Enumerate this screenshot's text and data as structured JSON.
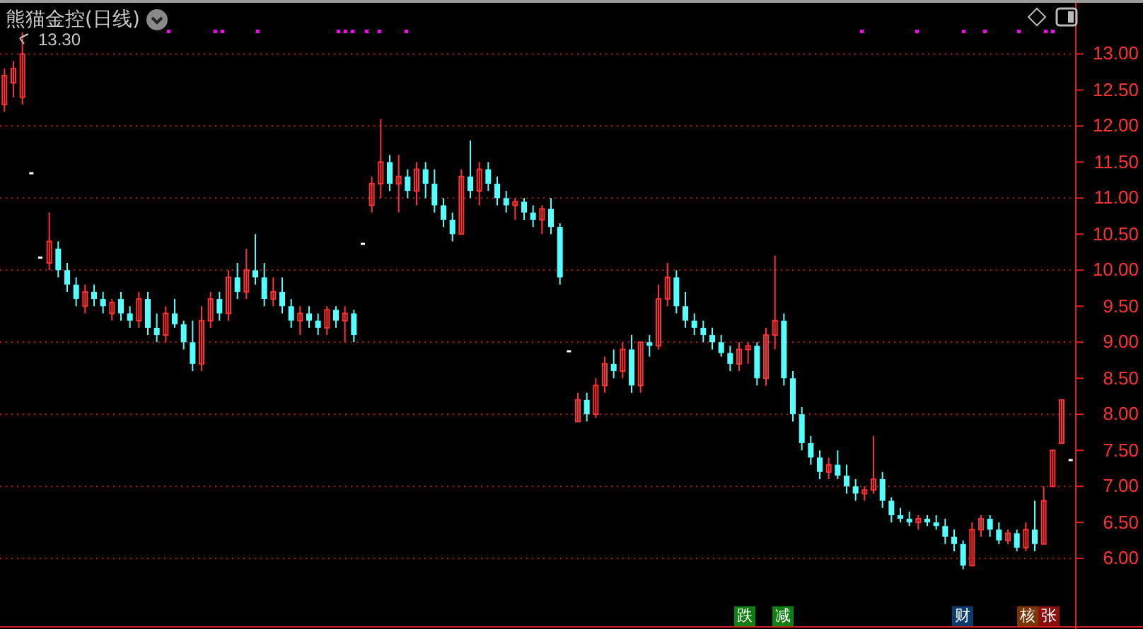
{
  "chart": {
    "title": "熊猫金控(日线)",
    "high_label": "13.30",
    "chart_data": {
      "type": "candlestick",
      "ylim": [
        5.06,
        13.71
      ],
      "grid": true,
      "categories": [
        null,
        null,
        null,
        null,
        null,
        null,
        null,
        null,
        null,
        null,
        null,
        null,
        null,
        null,
        null,
        null,
        null,
        null,
        null,
        null,
        null,
        null,
        null,
        null,
        null,
        null,
        null,
        null,
        null,
        null,
        null,
        null,
        null,
        null,
        null,
        null,
        null,
        null,
        null,
        null,
        null,
        null,
        null,
        null,
        null,
        null,
        null,
        null,
        null,
        null,
        null,
        null,
        null,
        null,
        null,
        null,
        null,
        null,
        null,
        null,
        null,
        null,
        null,
        null,
        null,
        null,
        null,
        null,
        null,
        null,
        null,
        null,
        null,
        null,
        null,
        null,
        null,
        null,
        null,
        null,
        null,
        null,
        null,
        null,
        null,
        null,
        null,
        null,
        null,
        null,
        null,
        null,
        null,
        null,
        null,
        null,
        null,
        null,
        null,
        null,
        null,
        null,
        null,
        null,
        null,
        null,
        null,
        null,
        null,
        null,
        null,
        null,
        null,
        null,
        null,
        null,
        null,
        null,
        null,
        null
      ],
      "yticks": [
        {
          "value": 13,
          "label": "13.00"
        },
        {
          "value": 12.5,
          "label": "12.50"
        },
        {
          "value": 12,
          "label": "12.00"
        },
        {
          "value": 11.5,
          "label": "11.50"
        },
        {
          "value": 11,
          "label": "11.00"
        },
        {
          "value": 10.5,
          "label": "10.50"
        },
        {
          "value": 10,
          "label": "10.00"
        },
        {
          "value": 9.5,
          "label": "9.50"
        },
        {
          "value": 9,
          "label": "9.00"
        },
        {
          "value": 8.5,
          "label": "8.50"
        },
        {
          "value": 8,
          "label": "8.00"
        },
        {
          "value": 7.5,
          "label": "7.50"
        },
        {
          "value": 7,
          "label": "7.00"
        },
        {
          "value": 6.5,
          "label": "6.50"
        },
        {
          "value": 6,
          "label": "6.00"
        }
      ],
      "ohlc": [
        [
          12.3,
          12.8,
          12.2,
          12.7
        ],
        [
          12.6,
          12.9,
          12.4,
          12.8
        ],
        [
          12.4,
          13.3,
          12.3,
          13.0
        ],
        [
          11.35,
          11.35,
          11.35,
          11.35
        ],
        [
          10.18,
          10.18,
          10.18,
          10.18
        ],
        [
          10.1,
          10.8,
          10.0,
          10.4
        ],
        [
          10.3,
          10.4,
          9.9,
          10.0
        ],
        [
          10.0,
          10.1,
          9.7,
          9.8
        ],
        [
          9.8,
          9.9,
          9.5,
          9.6
        ],
        [
          9.5,
          9.8,
          9.4,
          9.7
        ],
        [
          9.7,
          9.8,
          9.5,
          9.6
        ],
        [
          9.6,
          9.7,
          9.4,
          9.5
        ],
        [
          9.4,
          9.6,
          9.3,
          9.55
        ],
        [
          9.6,
          9.7,
          9.3,
          9.4
        ],
        [
          9.4,
          9.5,
          9.2,
          9.3
        ],
        [
          9.3,
          9.7,
          9.2,
          9.6
        ],
        [
          9.6,
          9.7,
          9.1,
          9.2
        ],
        [
          9.2,
          9.4,
          9.0,
          9.1
        ],
        [
          9.1,
          9.5,
          9.0,
          9.4
        ],
        [
          9.4,
          9.6,
          9.2,
          9.25
        ],
        [
          9.25,
          9.3,
          8.9,
          9.0
        ],
        [
          9.0,
          9.3,
          8.6,
          8.7
        ],
        [
          8.7,
          9.5,
          8.6,
          9.3
        ],
        [
          9.3,
          9.7,
          9.2,
          9.6
        ],
        [
          9.6,
          9.7,
          9.3,
          9.4
        ],
        [
          9.4,
          10.0,
          9.3,
          9.9
        ],
        [
          9.9,
          10.1,
          9.6,
          9.7
        ],
        [
          9.7,
          10.3,
          9.6,
          10.0
        ],
        [
          10.0,
          10.5,
          9.8,
          9.9
        ],
        [
          9.9,
          10.1,
          9.5,
          9.6
        ],
        [
          9.6,
          9.9,
          9.5,
          9.7
        ],
        [
          9.7,
          9.9,
          9.4,
          9.5
        ],
        [
          9.5,
          9.6,
          9.2,
          9.3
        ],
        [
          9.3,
          9.5,
          9.1,
          9.4
        ],
        [
          9.4,
          9.5,
          9.2,
          9.3
        ],
        [
          9.3,
          9.4,
          9.1,
          9.2
        ],
        [
          9.2,
          9.5,
          9.1,
          9.45
        ],
        [
          9.45,
          9.5,
          9.2,
          9.3
        ],
        [
          9.3,
          9.5,
          9.0,
          9.4
        ],
        [
          9.4,
          9.45,
          9.0,
          9.1
        ],
        [
          10.37,
          10.37,
          10.37,
          10.37
        ],
        [
          10.9,
          11.3,
          10.8,
          11.2
        ],
        [
          11.2,
          12.1,
          11.0,
          11.5
        ],
        [
          11.5,
          11.6,
          11.1,
          11.2
        ],
        [
          11.2,
          11.6,
          10.8,
          11.3
        ],
        [
          11.3,
          11.4,
          11.0,
          11.1
        ],
        [
          11.1,
          11.5,
          10.9,
          11.4
        ],
        [
          11.4,
          11.5,
          11.0,
          11.2
        ],
        [
          11.2,
          11.4,
          10.8,
          10.9
        ],
        [
          10.9,
          11.0,
          10.6,
          10.7
        ],
        [
          10.7,
          10.8,
          10.4,
          10.5
        ],
        [
          10.5,
          11.4,
          10.5,
          11.3
        ],
        [
          11.3,
          11.8,
          11.0,
          11.1
        ],
        [
          11.1,
          11.5,
          10.9,
          11.4
        ],
        [
          11.4,
          11.5,
          11.1,
          11.2
        ],
        [
          11.2,
          11.3,
          10.9,
          11.0
        ],
        [
          11.0,
          11.1,
          10.8,
          10.9
        ],
        [
          10.9,
          11.0,
          10.7,
          10.95
        ],
        [
          10.95,
          11.0,
          10.7,
          10.8
        ],
        [
          10.8,
          10.9,
          10.6,
          10.7
        ],
        [
          10.7,
          10.9,
          10.5,
          10.85
        ],
        [
          10.85,
          11.0,
          10.5,
          10.6
        ],
        [
          10.6,
          10.65,
          9.8,
          9.9
        ],
        [
          8.88,
          8.88,
          8.88,
          8.88
        ],
        [
          7.9,
          8.3,
          7.9,
          8.2
        ],
        [
          8.2,
          8.3,
          7.9,
          8.0
        ],
        [
          8.0,
          8.5,
          7.95,
          8.4
        ],
        [
          8.4,
          8.8,
          8.3,
          8.7
        ],
        [
          8.7,
          8.9,
          8.5,
          8.6
        ],
        [
          8.6,
          9.0,
          8.5,
          8.9
        ],
        [
          8.9,
          9.1,
          8.3,
          8.4
        ],
        [
          8.4,
          9.0,
          8.3,
          9.0
        ],
        [
          9.0,
          9.1,
          8.8,
          8.95
        ],
        [
          8.95,
          9.8,
          8.9,
          9.6
        ],
        [
          9.6,
          10.1,
          9.5,
          9.9
        ],
        [
          9.9,
          10.0,
          9.4,
          9.5
        ],
        [
          9.5,
          9.7,
          9.2,
          9.3
        ],
        [
          9.3,
          9.4,
          9.1,
          9.2
        ],
        [
          9.2,
          9.3,
          9.0,
          9.1
        ],
        [
          9.1,
          9.2,
          8.9,
          9.0
        ],
        [
          9.0,
          9.1,
          8.8,
          8.85
        ],
        [
          8.85,
          8.95,
          8.6,
          8.7
        ],
        [
          8.7,
          9.0,
          8.6,
          8.9
        ],
        [
          8.9,
          9.0,
          8.7,
          8.95
        ],
        [
          8.95,
          9.0,
          8.4,
          8.5
        ],
        [
          8.5,
          9.2,
          8.4,
          9.1
        ],
        [
          9.1,
          10.2,
          8.9,
          9.3
        ],
        [
          9.3,
          9.4,
          8.4,
          8.5
        ],
        [
          8.5,
          8.6,
          7.9,
          8.0
        ],
        [
          8.0,
          8.1,
          7.5,
          7.6
        ],
        [
          7.6,
          7.7,
          7.3,
          7.4
        ],
        [
          7.4,
          7.5,
          7.1,
          7.2
        ],
        [
          7.2,
          7.4,
          7.1,
          7.3
        ],
        [
          7.3,
          7.5,
          7.1,
          7.15
        ],
        [
          7.15,
          7.3,
          6.9,
          7.0
        ],
        [
          7.0,
          7.1,
          6.8,
          6.9
        ],
        [
          6.9,
          7.0,
          6.8,
          6.95
        ],
        [
          6.95,
          7.7,
          6.9,
          7.1
        ],
        [
          7.1,
          7.2,
          6.7,
          6.8
        ],
        [
          6.8,
          6.85,
          6.5,
          6.6
        ],
        [
          6.6,
          6.7,
          6.5,
          6.55
        ],
        [
          6.55,
          6.65,
          6.45,
          6.5
        ],
        [
          6.5,
          6.6,
          6.4,
          6.55
        ],
        [
          6.55,
          6.6,
          6.45,
          6.5
        ],
        [
          6.5,
          6.6,
          6.4,
          6.45
        ],
        [
          6.45,
          6.55,
          6.2,
          6.3
        ],
        [
          6.3,
          6.4,
          6.1,
          6.2
        ],
        [
          6.2,
          6.25,
          5.85,
          5.9
        ],
        [
          5.9,
          6.5,
          5.9,
          6.4
        ],
        [
          6.4,
          6.6,
          6.3,
          6.55
        ],
        [
          6.55,
          6.6,
          6.3,
          6.4
        ],
        [
          6.4,
          6.5,
          6.2,
          6.25
        ],
        [
          6.25,
          6.4,
          6.2,
          6.35
        ],
        [
          6.35,
          6.4,
          6.1,
          6.15
        ],
        [
          6.15,
          6.5,
          6.1,
          6.4
        ],
        [
          6.4,
          6.8,
          6.1,
          6.2
        ],
        [
          6.2,
          7.0,
          6.2,
          6.8
        ],
        [
          7.0,
          7.5,
          7.0,
          7.5
        ],
        [
          7.6,
          8.2,
          7.6,
          8.2
        ],
        [
          7.37,
          7.37,
          7.37,
          7.37
        ]
      ]
    },
    "badges": [
      {
        "text": "跌",
        "color": "#0f7f12"
      },
      {
        "text": "减",
        "color": "#0f7f12"
      },
      {
        "text": "财",
        "color": "#0c3b70"
      },
      {
        "text": "核",
        "color": "#7a3500"
      },
      {
        "text": "张",
        "color": "#8a0e0e"
      }
    ]
  }
}
